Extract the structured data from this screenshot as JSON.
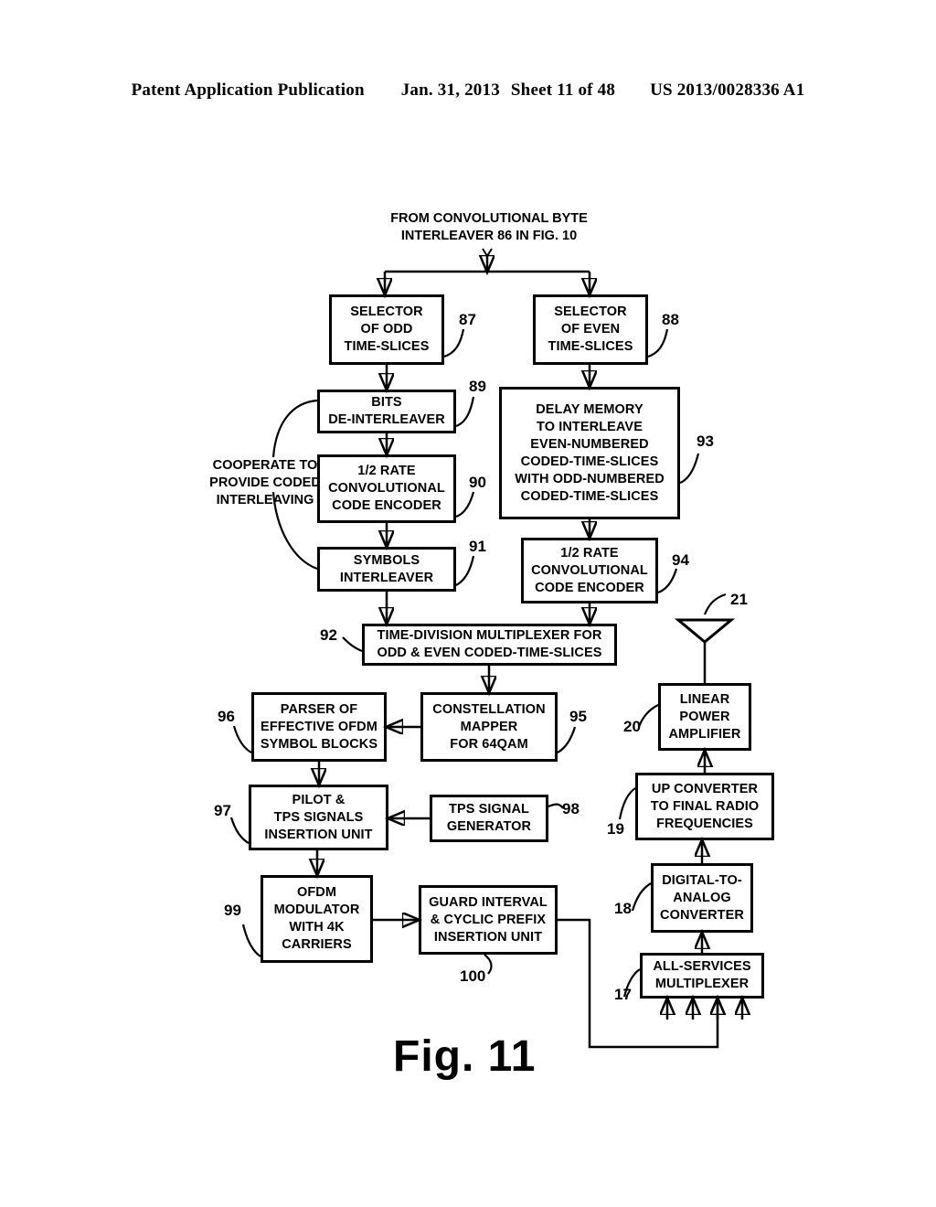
{
  "header": {
    "publication": "Patent Application Publication",
    "date": "Jan. 31, 2013",
    "sheet": "Sheet 11 of 48",
    "docnum": "US 2013/0028336 A1"
  },
  "figure": {
    "label": "Fig. 11",
    "source_caption": "FROM CONVOLUTIONAL BYTE\nINTERLEAVER 86 IN FIG. 10",
    "brace_caption": "COOPERATE TO\nPROVIDE CODED\nINTERLEAVING"
  },
  "blocks": [
    {
      "id": "b87",
      "ref": "87",
      "label": "SELECTOR\nOF ODD\nTIME-SLICES"
    },
    {
      "id": "b88",
      "ref": "88",
      "label": "SELECTOR\nOF EVEN\nTIME-SLICES"
    },
    {
      "id": "b89",
      "ref": "89",
      "label": "BITS\nDE-INTERLEAVER"
    },
    {
      "id": "b90",
      "ref": "90",
      "label": "1/2 RATE\nCONVOLUTIONAL\nCODE ENCODER"
    },
    {
      "id": "b91",
      "ref": "91",
      "label": "SYMBOLS\nINTERLEAVER"
    },
    {
      "id": "b93",
      "ref": "93",
      "label": "DELAY MEMORY\nTO INTERLEAVE\nEVEN-NUMBERED\nCODED-TIME-SLICES\nWITH ODD-NUMBERED\nCODED-TIME-SLICES"
    },
    {
      "id": "b94",
      "ref": "94",
      "label": "1/2 RATE\nCONVOLUTIONAL\nCODE ENCODER"
    },
    {
      "id": "b92",
      "ref": "92",
      "label": "TIME-DIVISION MULTIPLEXER FOR\nODD & EVEN CODED-TIME-SLICES"
    },
    {
      "id": "b96",
      "ref": "96",
      "label": "PARSER OF\nEFFECTIVE OFDM\nSYMBOL BLOCKS"
    },
    {
      "id": "b95",
      "ref": "95",
      "label": "CONSTELLATION\nMAPPER\nFOR 64QAM"
    },
    {
      "id": "b97",
      "ref": "97",
      "label": "PILOT &\nTPS SIGNALS\nINSERTION UNIT"
    },
    {
      "id": "b98",
      "ref": "98",
      "label": "TPS SIGNAL\nGENERATOR"
    },
    {
      "id": "b99",
      "ref": "99",
      "label": "OFDM\nMODULATOR\nWITH 4K\nCARRIERS"
    },
    {
      "id": "b100",
      "ref": "100",
      "label": "GUARD INTERVAL\n& CYCLIC PREFIX\nINSERTION UNIT"
    },
    {
      "id": "b20",
      "ref": "20",
      "label": "LINEAR\nPOWER\nAMPLIFIER"
    },
    {
      "id": "b19",
      "ref": "19",
      "label": "UP CONVERTER\nTO FINAL RADIO\nFREQUENCIES"
    },
    {
      "id": "b18",
      "ref": "18",
      "label": "DIGITAL-TO-\nANALOG\nCONVERTER"
    },
    {
      "id": "b17",
      "ref": "17",
      "label": "ALL-SERVICES\nMULTIPLEXER"
    }
  ],
  "antenna": {
    "ref": "21",
    "name": "transmit-antenna-icon"
  },
  "colors": {
    "ink": "#000000",
    "paper": "#ffffff"
  }
}
